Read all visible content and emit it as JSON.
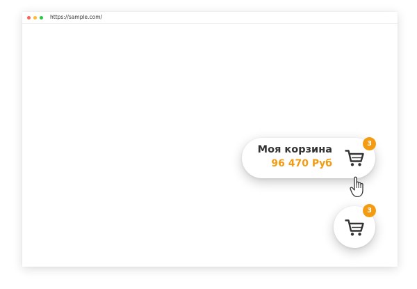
{
  "browser": {
    "url": "https://sample.com/",
    "dots": [
      "#ff5f57",
      "#febc2e",
      "#28c840"
    ]
  },
  "cart_expanded": {
    "title": "Моя корзина",
    "total": "96 470 Руб",
    "badge_count": "3",
    "icon": "shopping-cart-icon"
  },
  "cart_collapsed": {
    "badge_count": "3",
    "icon": "shopping-cart-icon"
  },
  "cursor": {
    "icon": "hand-pointer-icon"
  },
  "colors": {
    "accent": "#f39c12",
    "text": "#333333",
    "icon": "#333333"
  }
}
